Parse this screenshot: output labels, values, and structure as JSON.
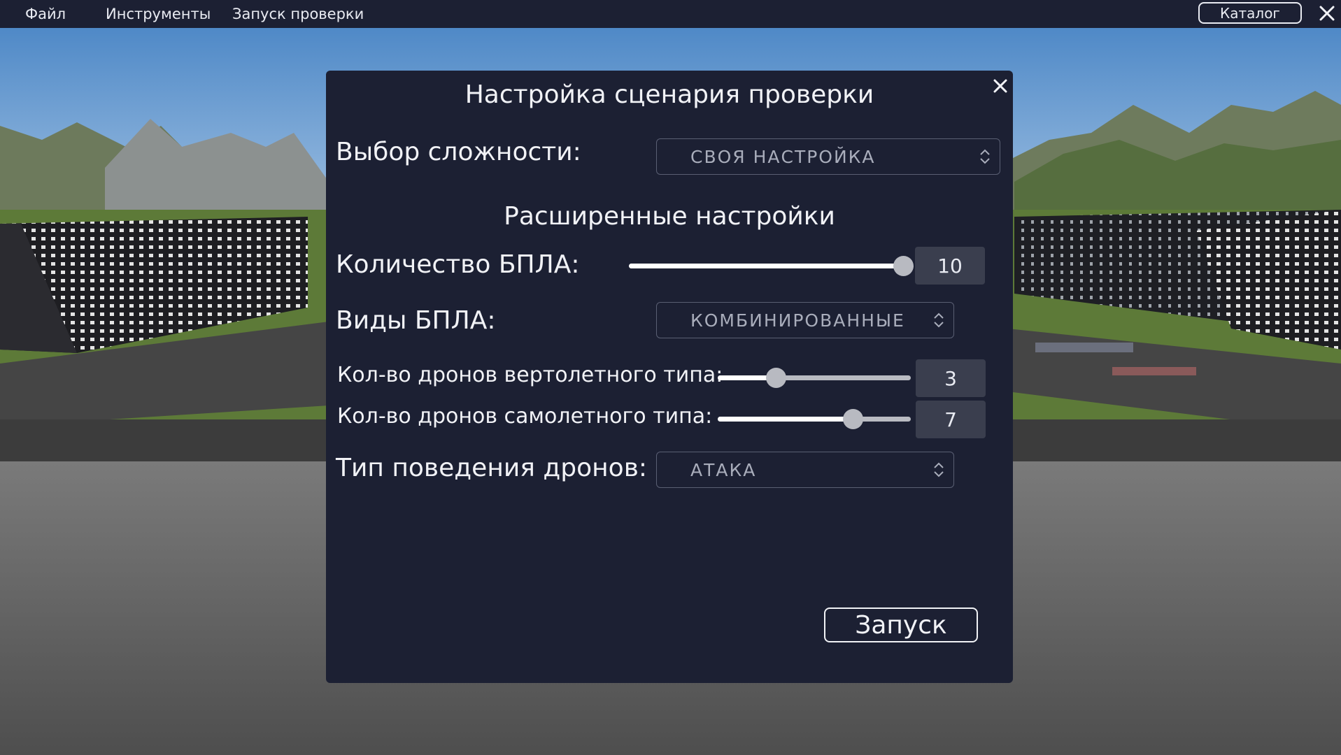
{
  "menubar": {
    "items": [
      {
        "label": "Файл"
      },
      {
        "label": "Инструменты"
      },
      {
        "label": "Запуск проверки"
      }
    ],
    "catalog_label": "Каталог",
    "close_icon": "close-icon"
  },
  "dialog": {
    "title": "Настройка сценария проверки",
    "close_icon": "close-icon",
    "difficulty": {
      "label": "Выбор сложности:",
      "value": "СВОЯ НАСТРОЙКА"
    },
    "advanced_title": "Расширенные настройки",
    "uav_count": {
      "label": "Количество БПЛА:",
      "value": "10",
      "level": 1.0
    },
    "uav_types": {
      "label": "Виды БПЛА:",
      "value": "КОМБИНИРОВАННЫЕ"
    },
    "helicopter_drones": {
      "label": "Кол-во дронов вертолетного типа:",
      "value": "3",
      "level": 0.3
    },
    "plane_drones": {
      "label": "Кол-во дронов самолетного типа:",
      "value": "7",
      "level": 0.7
    },
    "behavior": {
      "label": "Тип поведения дронов:",
      "value": "АТАКА"
    },
    "launch_label": "Запуск"
  },
  "colors": {
    "panel_bg": "#1c2033",
    "text": "#f1f2f6",
    "select_text": "#a9adbb",
    "numbox_bg": "#3a3e4e"
  }
}
